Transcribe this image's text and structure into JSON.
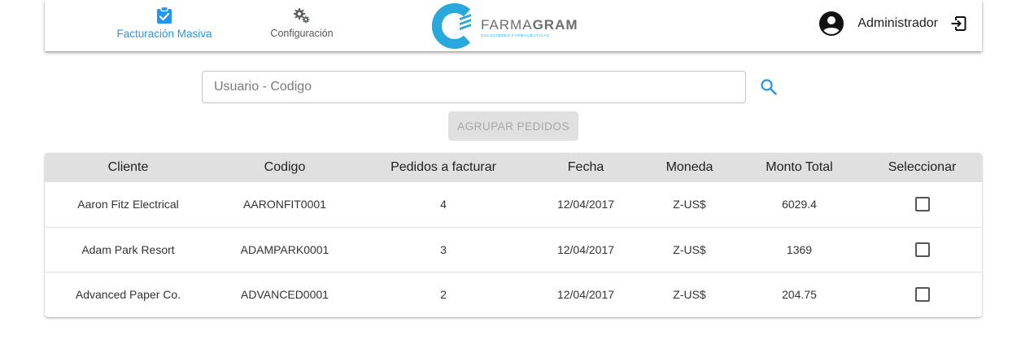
{
  "nav": {
    "items": [
      {
        "label": "Facturación Masiva",
        "icon": "clipboard-check-icon",
        "active": true
      },
      {
        "label": "Configuración",
        "icon": "gears-icon",
        "active": false
      }
    ]
  },
  "logo": {
    "brand_light": "FARMA",
    "brand_bold": "GRAM",
    "tagline": "SOLUCIONES FARMACÉUTICAS"
  },
  "user": {
    "name": "Administrador",
    "avatar_icon": "account-circle-icon",
    "logout_icon": "logout-icon"
  },
  "search": {
    "value": "",
    "placeholder": "Usuario - Codigo",
    "icon": "search-icon"
  },
  "group_button": {
    "label": "AGRUPAR PEDIDOS",
    "disabled": true
  },
  "table": {
    "columns": [
      "Cliente",
      "Codigo",
      "Pedidos a facturar",
      "Fecha",
      "Moneda",
      "Monto Total",
      "Seleccionar"
    ],
    "rows": [
      {
        "cliente": "Aaron Fitz Electrical",
        "codigo": "AARONFIT0001",
        "pedidos": "4",
        "fecha": "12/04/2017",
        "moneda": "Z-US$",
        "monto": "6029.4",
        "selected": false
      },
      {
        "cliente": "Adam Park Resort",
        "codigo": "ADAMPARK0001",
        "pedidos": "3",
        "fecha": "12/04/2017",
        "moneda": "Z-US$",
        "monto": "1369",
        "selected": false
      },
      {
        "cliente": "Advanced Paper Co.",
        "codigo": "ADVANCED0001",
        "pedidos": "2",
        "fecha": "12/04/2017",
        "moneda": "Z-US$",
        "monto": "204.75",
        "selected": false
      }
    ]
  },
  "colors": {
    "accent": "#2196f3",
    "header_bg": "#e0e0e0",
    "logo_blue": "#29a8e0",
    "logo_gray": "#6d6e71"
  }
}
